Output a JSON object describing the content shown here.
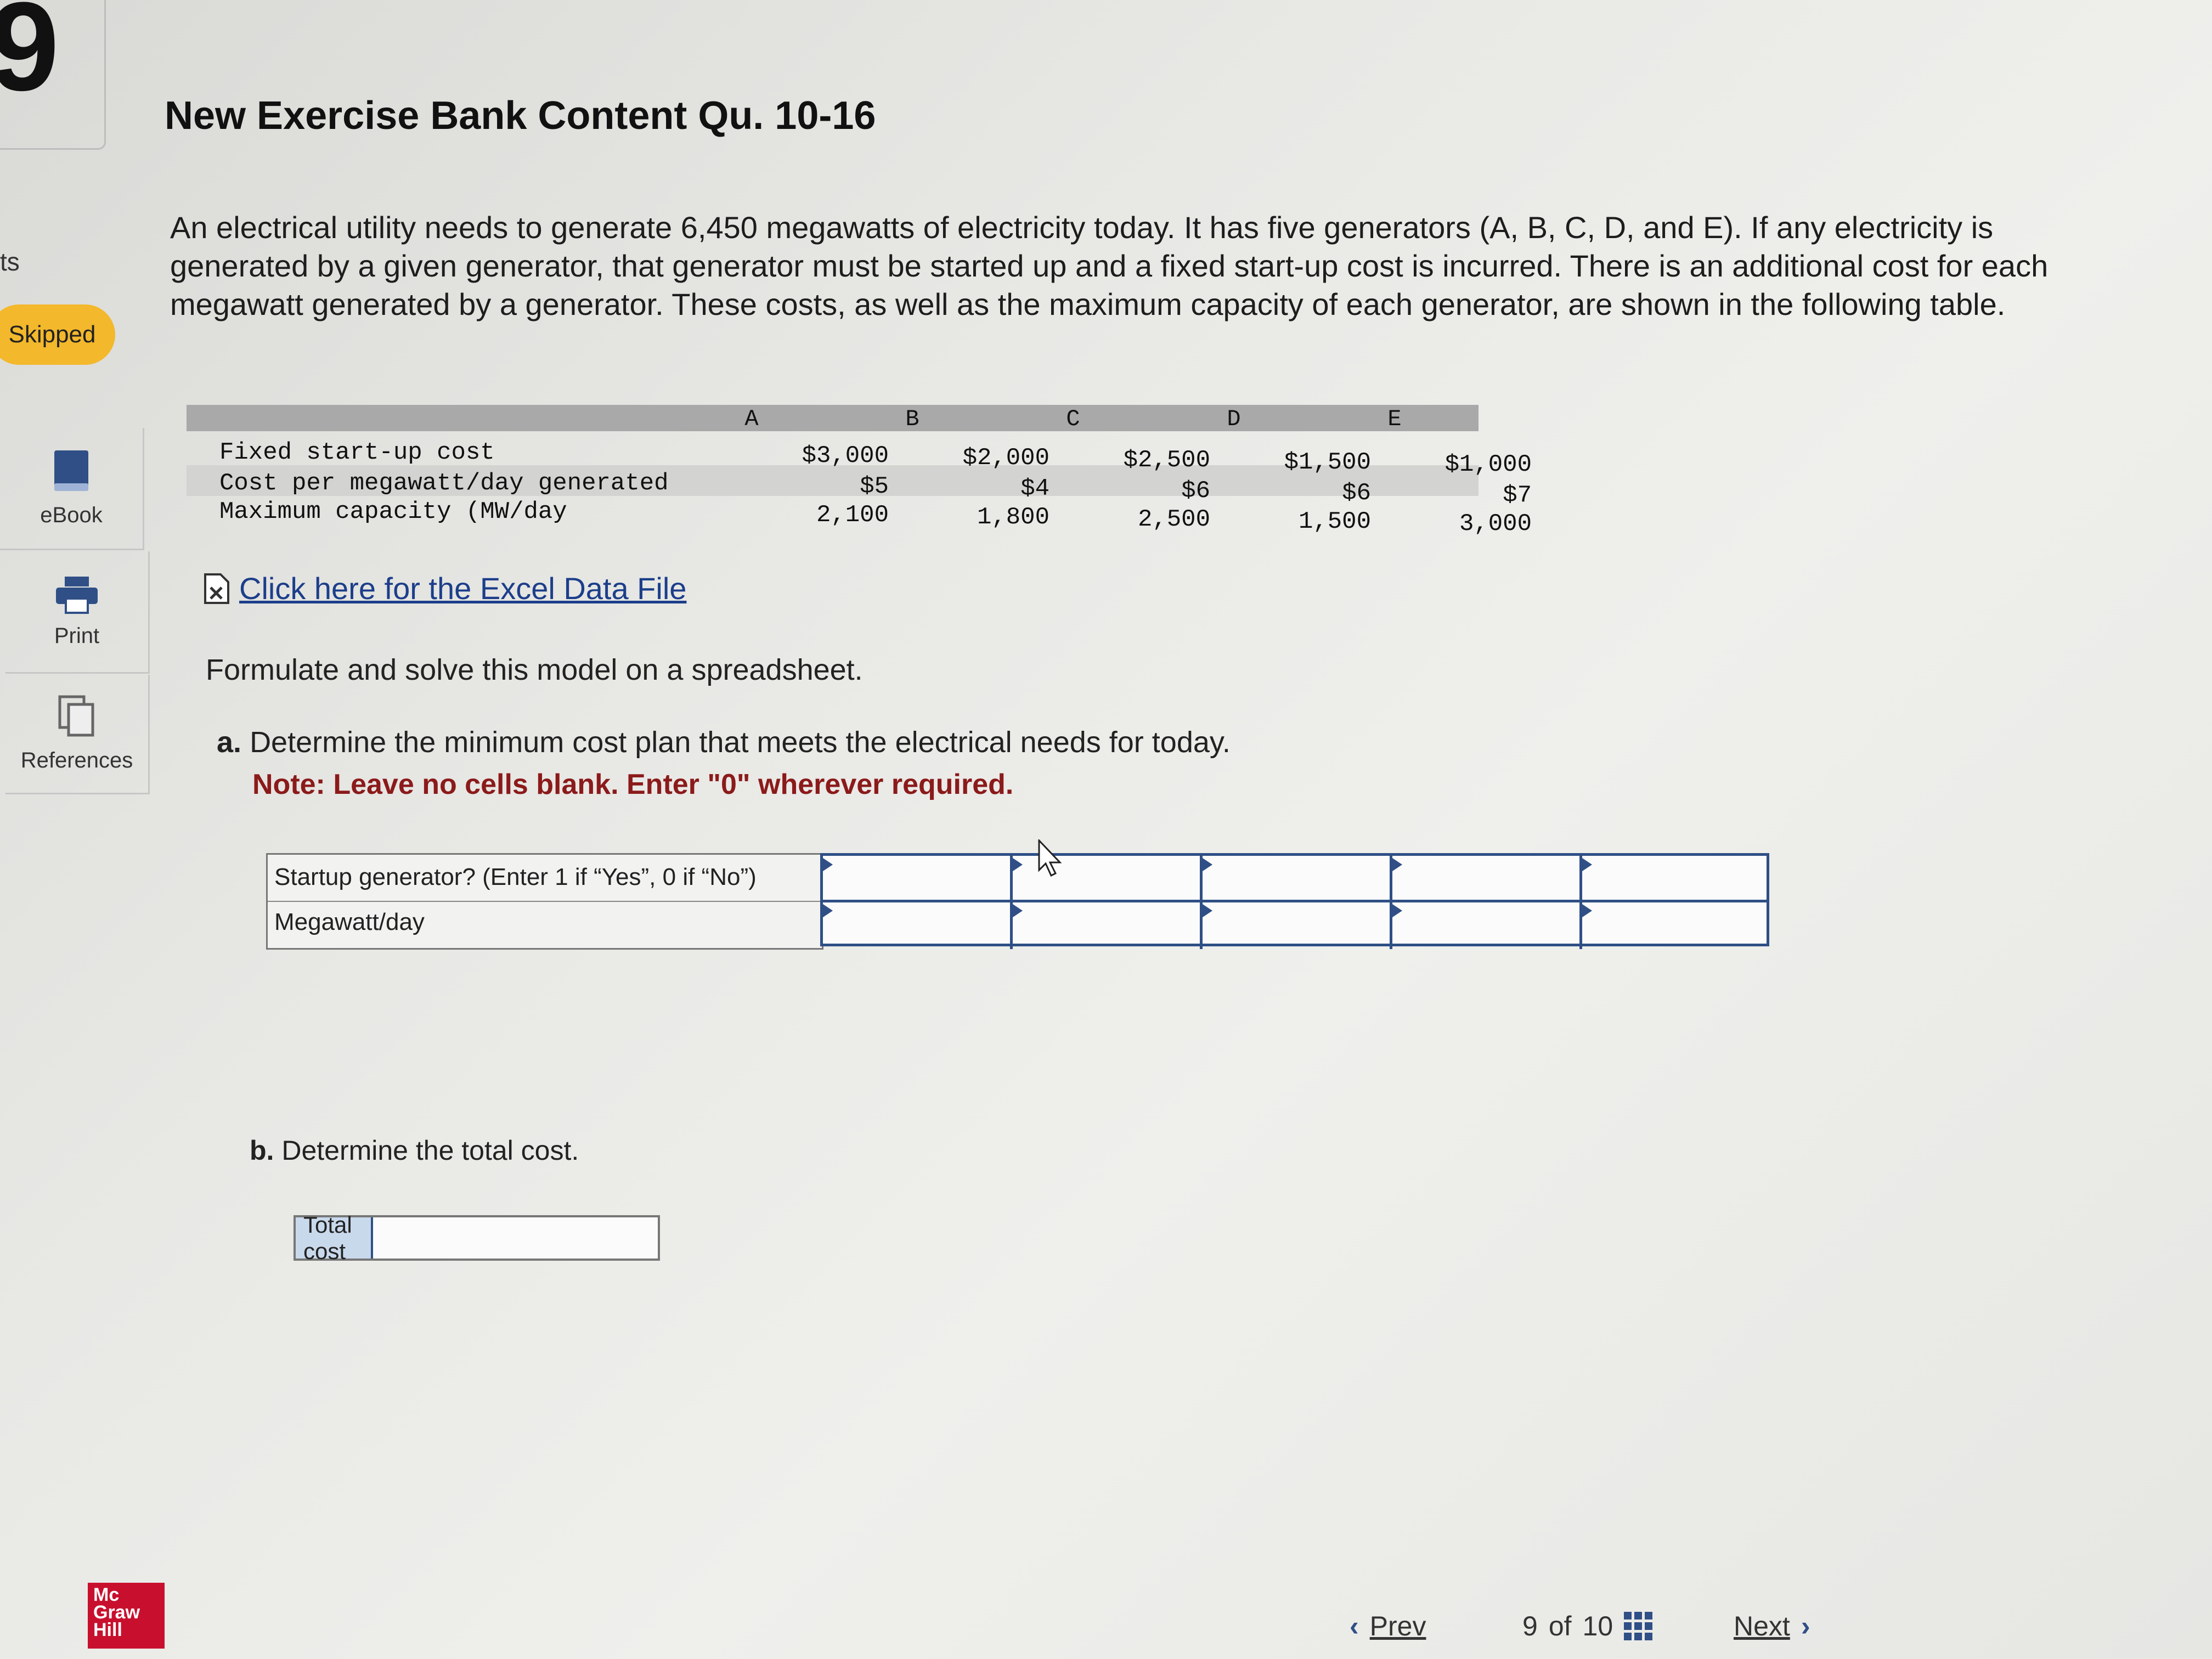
{
  "rail": {
    "question_number": "9",
    "partial_label": "ts",
    "skipped_badge": "Skipped",
    "tools": [
      {
        "label": "eBook",
        "icon": "ebook-icon"
      },
      {
        "label": "Print",
        "icon": "print-icon"
      },
      {
        "label": "References",
        "icon": "references-icon"
      }
    ]
  },
  "header": {
    "title": "New Exercise Bank Content Qu. 10-16"
  },
  "problem": {
    "intro": "An electrical utility needs to generate 6,450 megawatts of electricity today. It has five generators (A, B, C, D, and E). If any electricity is generated by a given generator, that generator must be started up and a fixed start-up cost is incurred. There is an additional cost for each megawatt generated by a generator. These costs, as well as the maximum capacity of each generator, are shown in the following table.",
    "table": {
      "columns": [
        "A",
        "B",
        "C",
        "D",
        "E"
      ],
      "rows": [
        {
          "label": "Fixed start-up cost",
          "values": [
            "$3,000",
            "$2,000",
            "$2,500",
            "$1,500",
            "$1,000"
          ]
        },
        {
          "label": "Cost per megawatt/day generated",
          "values": [
            "$5",
            "$4",
            "$6",
            "$6",
            "$7"
          ]
        },
        {
          "label": "Maximum capacity (MW/day",
          "values": [
            "2,100",
            "1,800",
            "2,500",
            "1,500",
            "3,000"
          ]
        }
      ]
    },
    "excel_link": "Click here for the Excel Data File",
    "formulate": "Formulate and solve this model on a spreadsheet.",
    "part_a": {
      "letter": "a.",
      "text": "Determine the minimum cost plan that meets the electrical needs for today.",
      "note": "Note: Leave no cells blank. Enter \"0\" wherever required."
    },
    "answer_grid": {
      "row_labels": [
        "Startup generator? (Enter 1 if “Yes”, 0 if “No”)",
        "Megawatt/day"
      ]
    },
    "part_b": {
      "letter": "b.",
      "text": "Determine the total cost.",
      "total_label": "Total cost"
    }
  },
  "footer": {
    "logo": [
      "Mc",
      "Graw",
      "Hill"
    ],
    "prev_label": "Prev",
    "page_current": "9",
    "page_of": "of",
    "page_total": "10",
    "next_label": "Next"
  },
  "colors": {
    "accent_blue": "#2f4f86",
    "note_red": "#8b1a1a",
    "skipped_yellow": "#f3b82b",
    "logo_red": "#c8102e"
  }
}
